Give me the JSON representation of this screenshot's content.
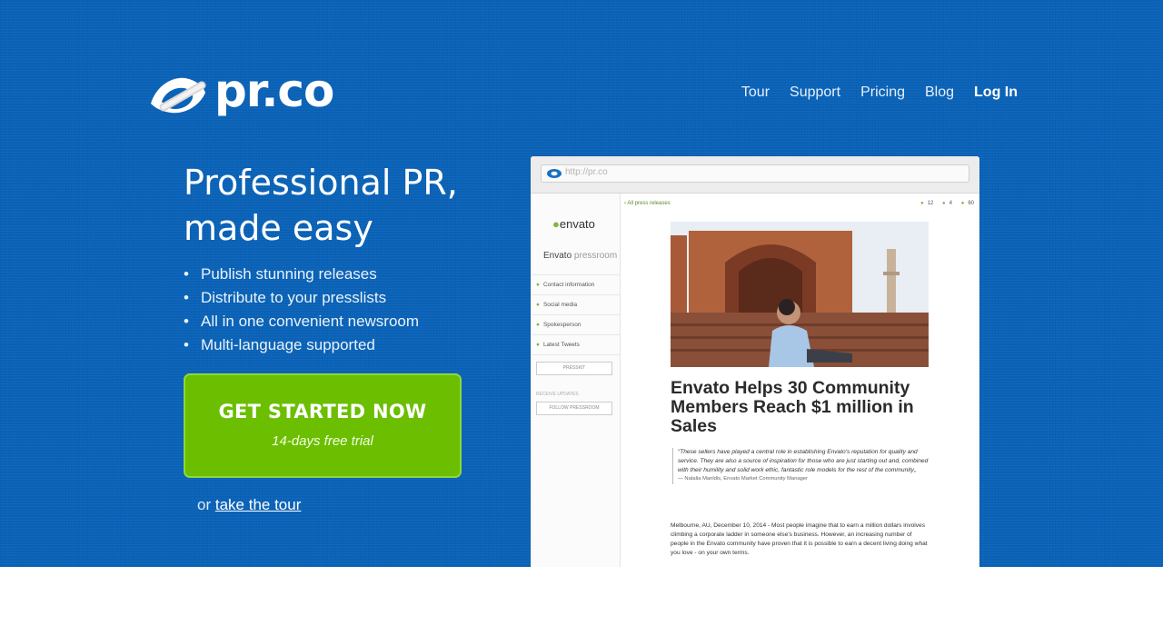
{
  "logo": {
    "text": "pr.co"
  },
  "nav": {
    "items": [
      "Tour",
      "Support",
      "Pricing",
      "Blog"
    ],
    "login": "Log In"
  },
  "hero": {
    "headline_line1": "Professional PR,",
    "headline_line2": "made easy",
    "features": [
      "Publish stunning releases",
      "Distribute to your presslists",
      "All in one convenient newsroom",
      "Multi-language supported"
    ],
    "cta": {
      "label": "GET STARTED NOW",
      "sublabel": "14-days free trial"
    },
    "tour_prefix": "or",
    "tour_link": "take the tour"
  },
  "screenshot": {
    "url": "http://pr.co",
    "brand": "envato",
    "pressroom_brand": "Envato",
    "pressroom_word": "pressroom",
    "sidebar_items": [
      "Contact information",
      "Social media",
      "Spokesperson",
      "Latest Tweets"
    ],
    "presskit_button": "PRESSKIT",
    "receive_updates": "RECEIVE UPDATES",
    "follow_button": "FOLLOW PRESSROOM",
    "back_link": "All press releases",
    "stats": [
      "12",
      "4",
      "60"
    ],
    "article_title": "Envato Helps 30 Community Members Reach $1 million in Sales",
    "quote": "“These sellers have played a central role in establishing Envato's reputation for quality and service. They are also a source of inspiration for those who are just starting out and, combined with their humility and solid work ethic, fantastic role models for the rest of the community„",
    "quote_author": "— Natalia Manldis, Envato Market Community Manager",
    "body": "Melbourne, AU, December 10, 2014 - Most people imagine that to earn a million dollars involves climbing a corporate ladder in someone else's business. However, an increasing number of people in the Envato community have proven that it is possible to earn a decent living doing what you love - on your own terms.",
    "colors": {
      "accent_green": "#7cb342"
    }
  },
  "colors": {
    "hero_blue": "#0a63b8",
    "cta_green": "#6bbe00",
    "cta_border": "#8ed83a"
  }
}
